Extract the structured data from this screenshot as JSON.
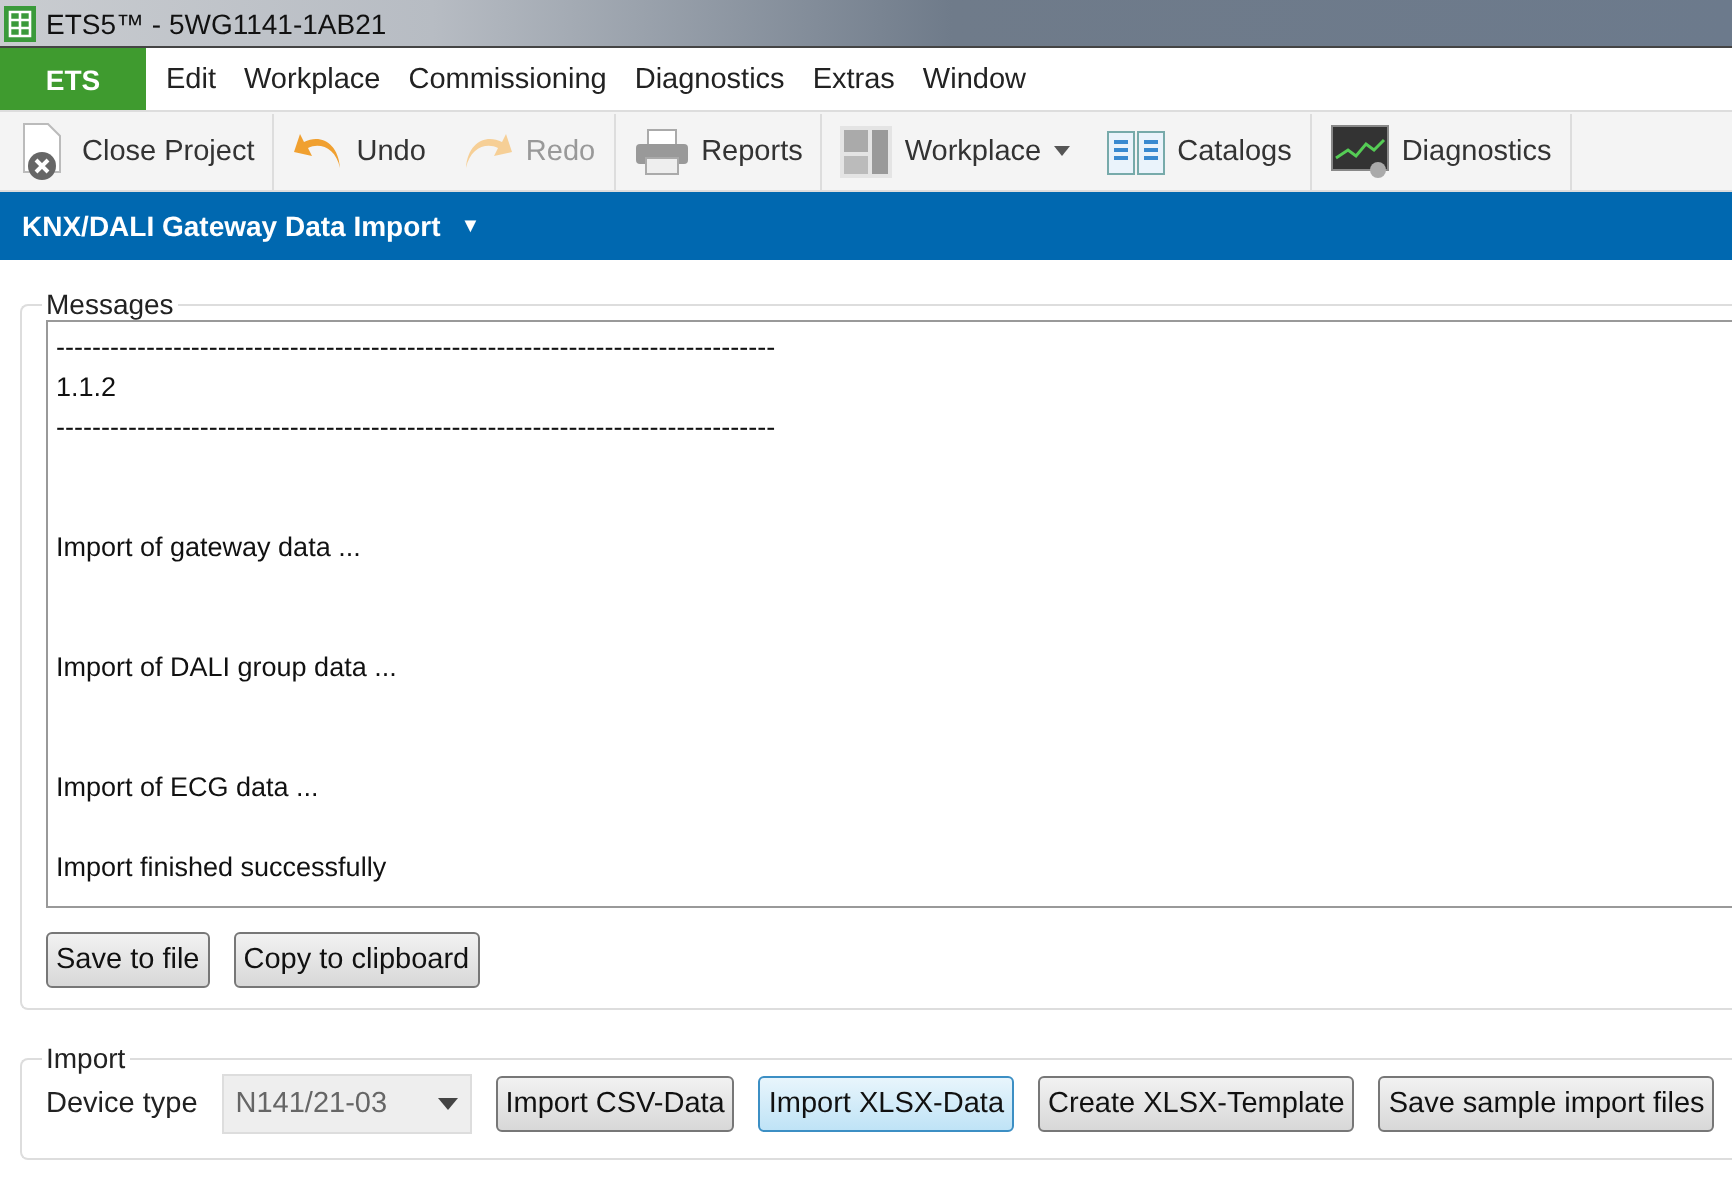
{
  "window": {
    "title": "ETS5™ - 5WG1141-1AB21"
  },
  "menu": {
    "app_button": "ETS",
    "items": [
      "Edit",
      "Workplace",
      "Commissioning",
      "Diagnostics",
      "Extras",
      "Window"
    ]
  },
  "toolbar": [
    [
      {
        "label": "Close Project",
        "kind": "close",
        "disabled": false,
        "dropdown": false
      }
    ],
    [
      {
        "label": "Undo",
        "kind": "undo",
        "disabled": false,
        "dropdown": false
      },
      {
        "label": "Redo",
        "kind": "redo",
        "disabled": true,
        "dropdown": false
      }
    ],
    [
      {
        "label": "Reports",
        "kind": "print",
        "disabled": false,
        "dropdown": false
      }
    ],
    [
      {
        "label": "Workplace",
        "kind": "layout",
        "disabled": false,
        "dropdown": true
      },
      {
        "label": "Catalogs",
        "kind": "catalog",
        "disabled": false,
        "dropdown": false
      }
    ],
    [
      {
        "label": "Diagnostics",
        "kind": "diagnostic",
        "disabled": false,
        "dropdown": false
      }
    ]
  ],
  "panel": {
    "title": "KNX/DALI Gateway Data Import",
    "caret": "▼"
  },
  "messages": {
    "legend": "Messages",
    "lines": [
      {
        "kind": "line",
        "text": "--------------------------------------------------------------------------------"
      },
      {
        "kind": "line",
        "text": "1.1.2"
      },
      {
        "kind": "line",
        "text": "--------------------------------------------------------------------------------"
      },
      {
        "kind": "section",
        "text": "Import of gateway data ..."
      },
      {
        "kind": "section",
        "text": "Import of DALI group data ..."
      },
      {
        "kind": "section",
        "text": "Import of ECG data ..."
      },
      {
        "kind": "result",
        "text": "Import finished successfully"
      }
    ],
    "buttons": [
      "Save to file",
      "Copy to clipboard"
    ]
  },
  "import": {
    "legend": "Import",
    "device_type_label": "Device type",
    "device_type": {
      "value": "N141/21-03",
      "disabled": true
    },
    "buttons": [
      {
        "label": "Import CSV-Data",
        "focused": false
      },
      {
        "label": "Import XLSX-Data",
        "focused": true
      },
      {
        "label": "Create XLSX-Template",
        "focused": false
      },
      {
        "label": "Save sample import files",
        "focused": false
      }
    ]
  }
}
